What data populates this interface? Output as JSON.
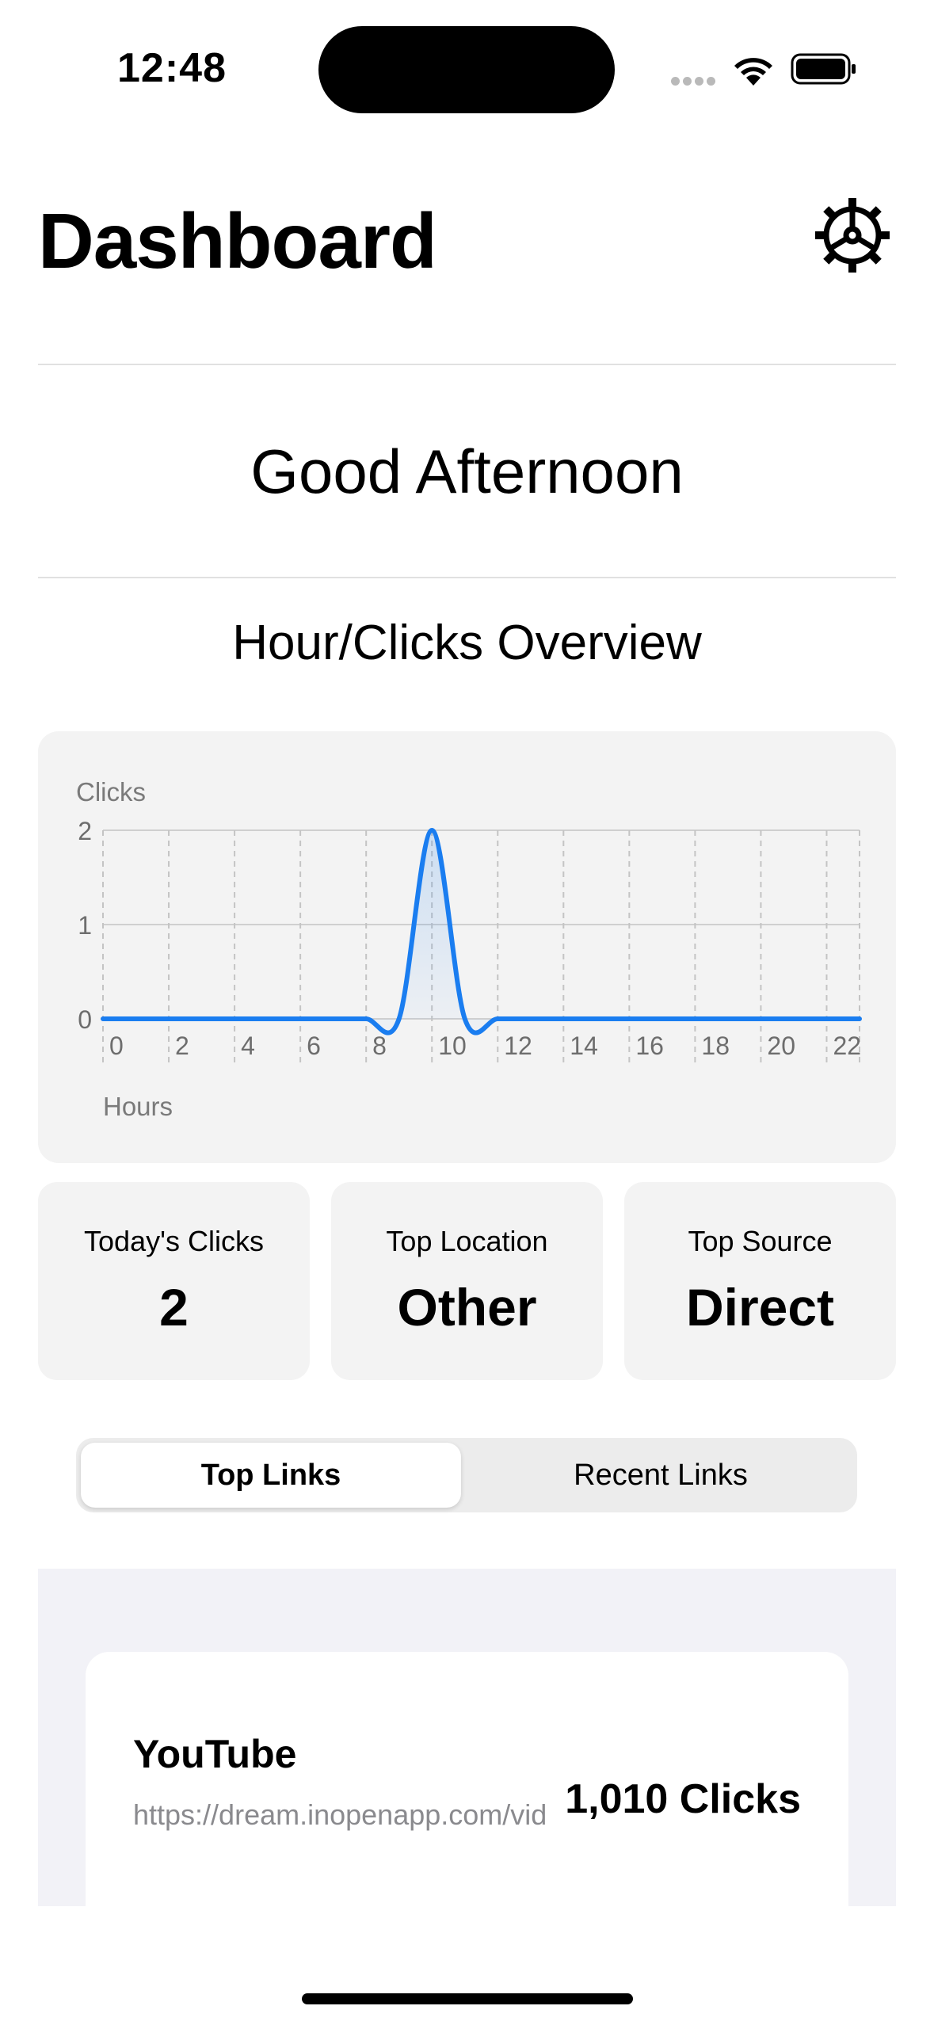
{
  "status_bar": {
    "time": "12:48"
  },
  "header": {
    "title": "Dashboard"
  },
  "greeting": "Good Afternoon",
  "overview": {
    "title": "Hour/Clicks Overview"
  },
  "chart_data": {
    "type": "line",
    "ylabel": "Clicks",
    "xlabel": "Hours",
    "x_ticks": [
      0,
      2,
      4,
      6,
      8,
      10,
      12,
      14,
      16,
      18,
      20,
      22
    ],
    "y_ticks": [
      0,
      1,
      2
    ],
    "xlim": [
      0,
      23
    ],
    "ylim": [
      0,
      2
    ],
    "grid": true,
    "series": [
      {
        "x": [
          0,
          1,
          2,
          3,
          4,
          5,
          6,
          7,
          8,
          9,
          10,
          11,
          12,
          13,
          14,
          15,
          16,
          17,
          18,
          19,
          20,
          21,
          22,
          23
        ],
        "values": [
          0,
          0,
          0,
          0,
          0,
          0,
          0,
          0,
          0,
          0,
          2,
          0,
          0,
          0,
          0,
          0,
          0,
          0,
          0,
          0,
          0,
          0,
          0,
          0
        ]
      }
    ],
    "colors": {
      "line": "#1a7df0"
    }
  },
  "stats": [
    {
      "label": "Today's Clicks",
      "value": "2"
    },
    {
      "label": "Top Location",
      "value": "Other"
    },
    {
      "label": "Top Source",
      "value": "Direct"
    }
  ],
  "tabs": [
    {
      "label": "Top Links",
      "selected": true
    },
    {
      "label": "Recent Links",
      "selected": false
    }
  ],
  "links": [
    {
      "title": "YouTube",
      "url": "https://dream.inopenapp.com/vid",
      "clicks": "1,010 Clicks"
    }
  ]
}
